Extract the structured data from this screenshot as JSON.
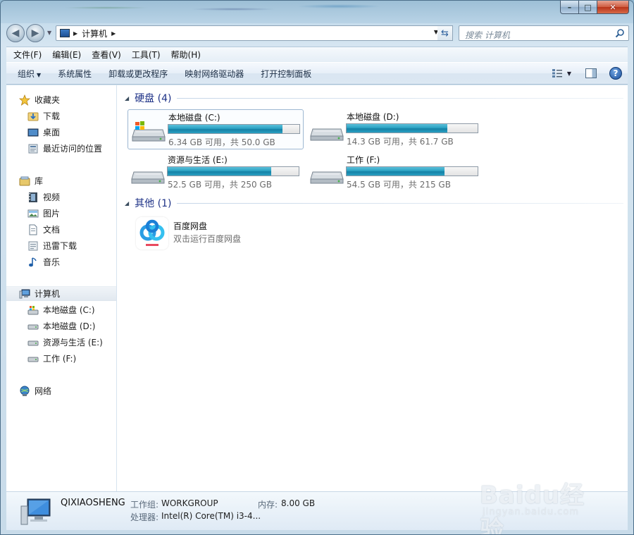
{
  "window": {
    "caption": {
      "minimize": "–",
      "maximize": "□",
      "close": "✕"
    }
  },
  "navigation": {
    "back_icon": "◀",
    "forward_icon": "▶",
    "address": {
      "path": "计算机"
    },
    "search": {
      "placeholder": "搜索 计算机"
    }
  },
  "menubar": {
    "items": [
      "文件(F)",
      "编辑(E)",
      "查看(V)",
      "工具(T)",
      "帮助(H)"
    ]
  },
  "commandbar": {
    "organize": "组织",
    "items": [
      "系统属性",
      "卸载或更改程序",
      "映射网络驱动器",
      "打开控制面板"
    ],
    "help": "?"
  },
  "navpane": {
    "favorites": {
      "label": "收藏夹",
      "items": [
        "下载",
        "桌面",
        "最近访问的位置"
      ]
    },
    "libraries": {
      "label": "库",
      "items": [
        "视频",
        "图片",
        "文档",
        "迅雷下载",
        "音乐"
      ]
    },
    "computer": {
      "label": "计算机",
      "items": [
        "本地磁盘 (C:)",
        "本地磁盘 (D:)",
        "资源与生活 (E:)",
        "工作 (F:)"
      ]
    },
    "network": {
      "label": "网络"
    }
  },
  "content": {
    "drives_group": "硬盘 (4)",
    "drives": [
      {
        "name": "本地磁盘 (C:)",
        "space": "6.34 GB 可用，共 50.0 GB",
        "used_fraction": 0.873
      },
      {
        "name": "本地磁盘 (D:)",
        "space": "14.3 GB 可用，共 61.7 GB",
        "used_fraction": 0.768
      },
      {
        "name": "资源与生活 (E:)",
        "space": "52.5 GB 可用，共 250 GB",
        "used_fraction": 0.79
      },
      {
        "name": "工作 (F:)",
        "space": "54.5 GB 可用，共 215 GB",
        "used_fraction": 0.747
      }
    ],
    "other_group": "其他 (1)",
    "other": {
      "name": "百度网盘",
      "desc": "双击运行百度网盘"
    }
  },
  "details": {
    "computer_name": "QIXIAOSHENG",
    "workgroup_label": "工作组:",
    "workgroup_value": "WORKGROUP",
    "memory_label": "内存:",
    "memory_value": "8.00 GB",
    "cpu_label": "处理器:",
    "cpu_value": "Intel(R) Core(TM) i3-4..."
  },
  "watermark": {
    "logo": "Baidu经验",
    "url": "jingyan.baidu.com"
  },
  "colors": {
    "bar_fill": "#2ba2c3",
    "group_title": "#1e3287",
    "accent_blue": "#1a4f9c"
  }
}
